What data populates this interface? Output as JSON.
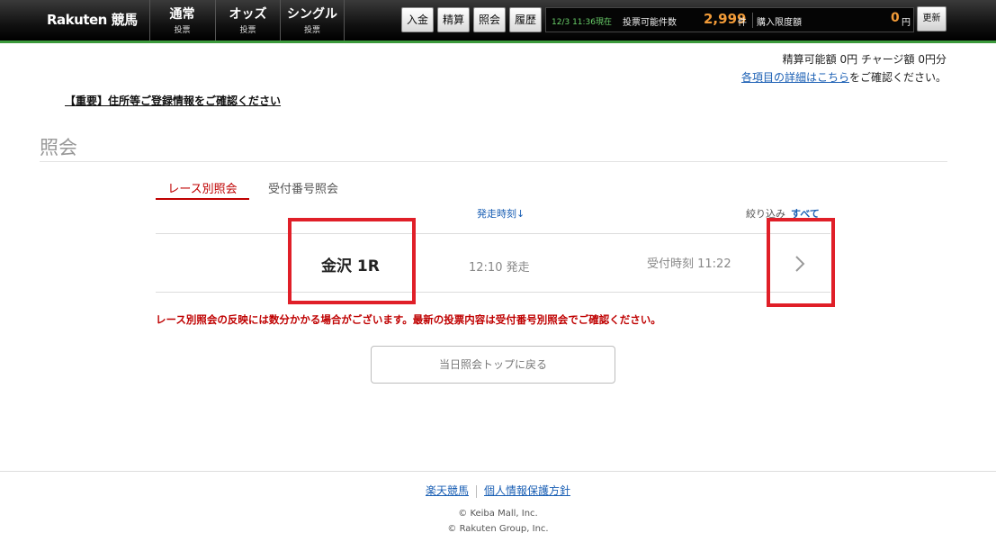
{
  "topbar": {
    "logo": "Rakuten 競馬",
    "nav": [
      {
        "label": "通常",
        "sub": "投票"
      },
      {
        "label": "オッズ",
        "sub": "投票"
      },
      {
        "label": "シングル",
        "sub": "投票"
      }
    ],
    "quick_buttons": [
      "入金",
      "精算",
      "照会",
      "履歴"
    ],
    "timestamp": "12/3 11:36現在",
    "vote_count_label": "投票可能件数",
    "vote_count": "2,999",
    "vote_count_unit": "件",
    "purchase_limit_label": "購入限度額",
    "purchase_limit": "0",
    "purchase_limit_unit": "円",
    "refresh_label": "更新"
  },
  "header": {
    "balance_text": "精算可能額 0円 チャージ額 0円分",
    "detail_link": "各項目の詳細はこちら",
    "detail_suffix": "をご確認ください。",
    "important_notice": "【重要】住所等ご登録情報をご確認ください"
  },
  "page": {
    "title": "照会",
    "tabs": [
      {
        "label": "レース別照会",
        "active": true
      },
      {
        "label": "受付番号照会",
        "active": false
      }
    ],
    "sort_header": "発走時刻↓",
    "filter_label": "絞り込み",
    "filter_value": "すべて"
  },
  "races": [
    {
      "name": "金沢 1R",
      "post_time": "12:10 発走",
      "received": "受付時刻 11:22"
    }
  ],
  "notice": "レース別照会の反映には数分かかる場合がございます。最新の投票内容は受付番号別照会でご確認ください。",
  "back_button": "当日照会トップに戻る",
  "footer": {
    "links": [
      "楽天競馬",
      "個人情報保護方針"
    ],
    "copyright": [
      "© Keiba Mall, Inc.",
      "© Rakuten Group, Inc."
    ]
  },
  "colors": {
    "accent_red": "#bf0000",
    "highlight_box": "#e01f28",
    "link_blue": "#1a5fb4",
    "count_orange": "#f29b38",
    "topbar_green_line": "#3c9a3c"
  }
}
